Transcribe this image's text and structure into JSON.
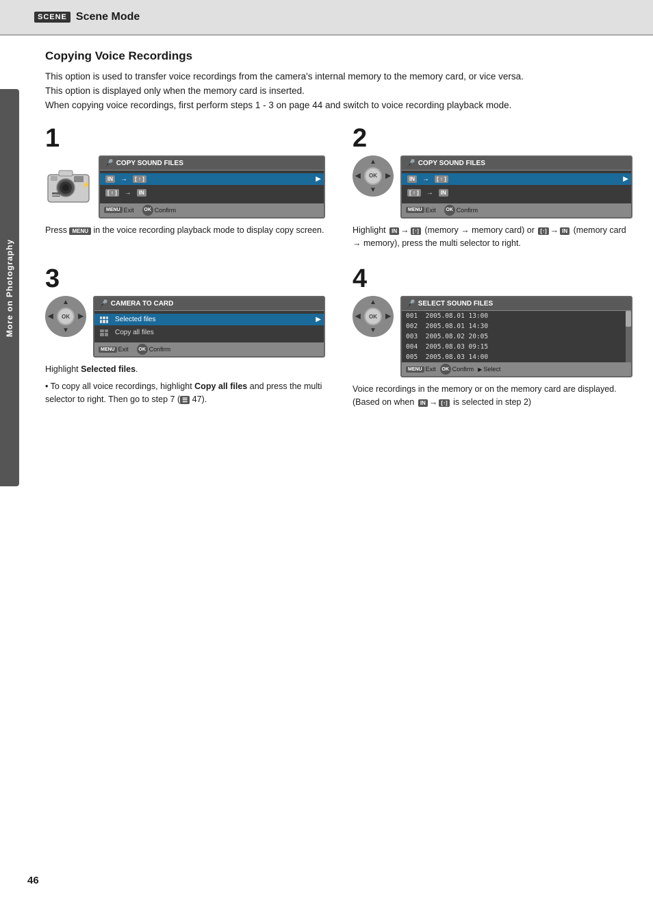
{
  "header": {
    "badge": "SCENE",
    "title": "Scene Mode"
  },
  "side_tab": {
    "label": "More on Photography"
  },
  "section": {
    "title": "Copying Voice Recordings",
    "intro": [
      "This option is used to transfer voice recordings from the camera's internal memory to the memory card, or vice versa.",
      "This option is displayed only when the memory card is inserted.",
      "When copying voice recordings, first perform steps 1 - 3 on page 44 and switch to voice recording playback mode."
    ]
  },
  "steps": [
    {
      "number": "1",
      "screen_title": "COPY SOUND FILES",
      "menu_items": [
        {
          "label": "IN→[↑]",
          "selected": true
        },
        {
          "label": "[↑]→IN",
          "selected": false
        }
      ],
      "footer": {
        "exit": "Exit",
        "confirm": "Confirm"
      },
      "description": "Press  in the voice recording playback mode to display copy screen."
    },
    {
      "number": "2",
      "screen_title": "COPY SOUND FILES",
      "menu_items": [
        {
          "label": "IN→[↑]",
          "selected": true
        },
        {
          "label": "[↑]→IN",
          "selected": false
        }
      ],
      "footer": {
        "exit": "Exit",
        "confirm": "Confirm"
      },
      "description": "Highlight  (memory → memory card) or  (memory card → memory), press the multi selector to right."
    },
    {
      "number": "3",
      "screen_title": "CAMERA TO CARD",
      "menu_items": [
        {
          "label": "Selected files",
          "selected": true
        },
        {
          "label": "Copy all files",
          "selected": false
        }
      ],
      "footer": {
        "exit": "Exit",
        "confirm": "Confirm"
      },
      "description": "Highlight Selected files.",
      "bullet": "To copy all voice recordings, highlight Copy all files and press the multi selector to right. Then go to step 7 (47)."
    },
    {
      "number": "4",
      "screen_title": "SELECT SOUND FILES",
      "files": [
        {
          "id": "001",
          "date": "2005.08.01",
          "time": "13:00"
        },
        {
          "id": "002",
          "date": "2005.08.01",
          "time": "14:30"
        },
        {
          "id": "003",
          "date": "2005.08.02",
          "time": "20:05"
        },
        {
          "id": "004",
          "date": "2005.08.03",
          "time": "09:15"
        },
        {
          "id": "005",
          "date": "2005.08.03",
          "time": "14:00"
        }
      ],
      "footer": {
        "exit": "Exit",
        "confirm": "Confirm",
        "select": "Select"
      },
      "description": "Voice recordings in the memory or on the memory card are displayed. (Based on when  is selected in step 2)"
    }
  ],
  "page_number": "46"
}
